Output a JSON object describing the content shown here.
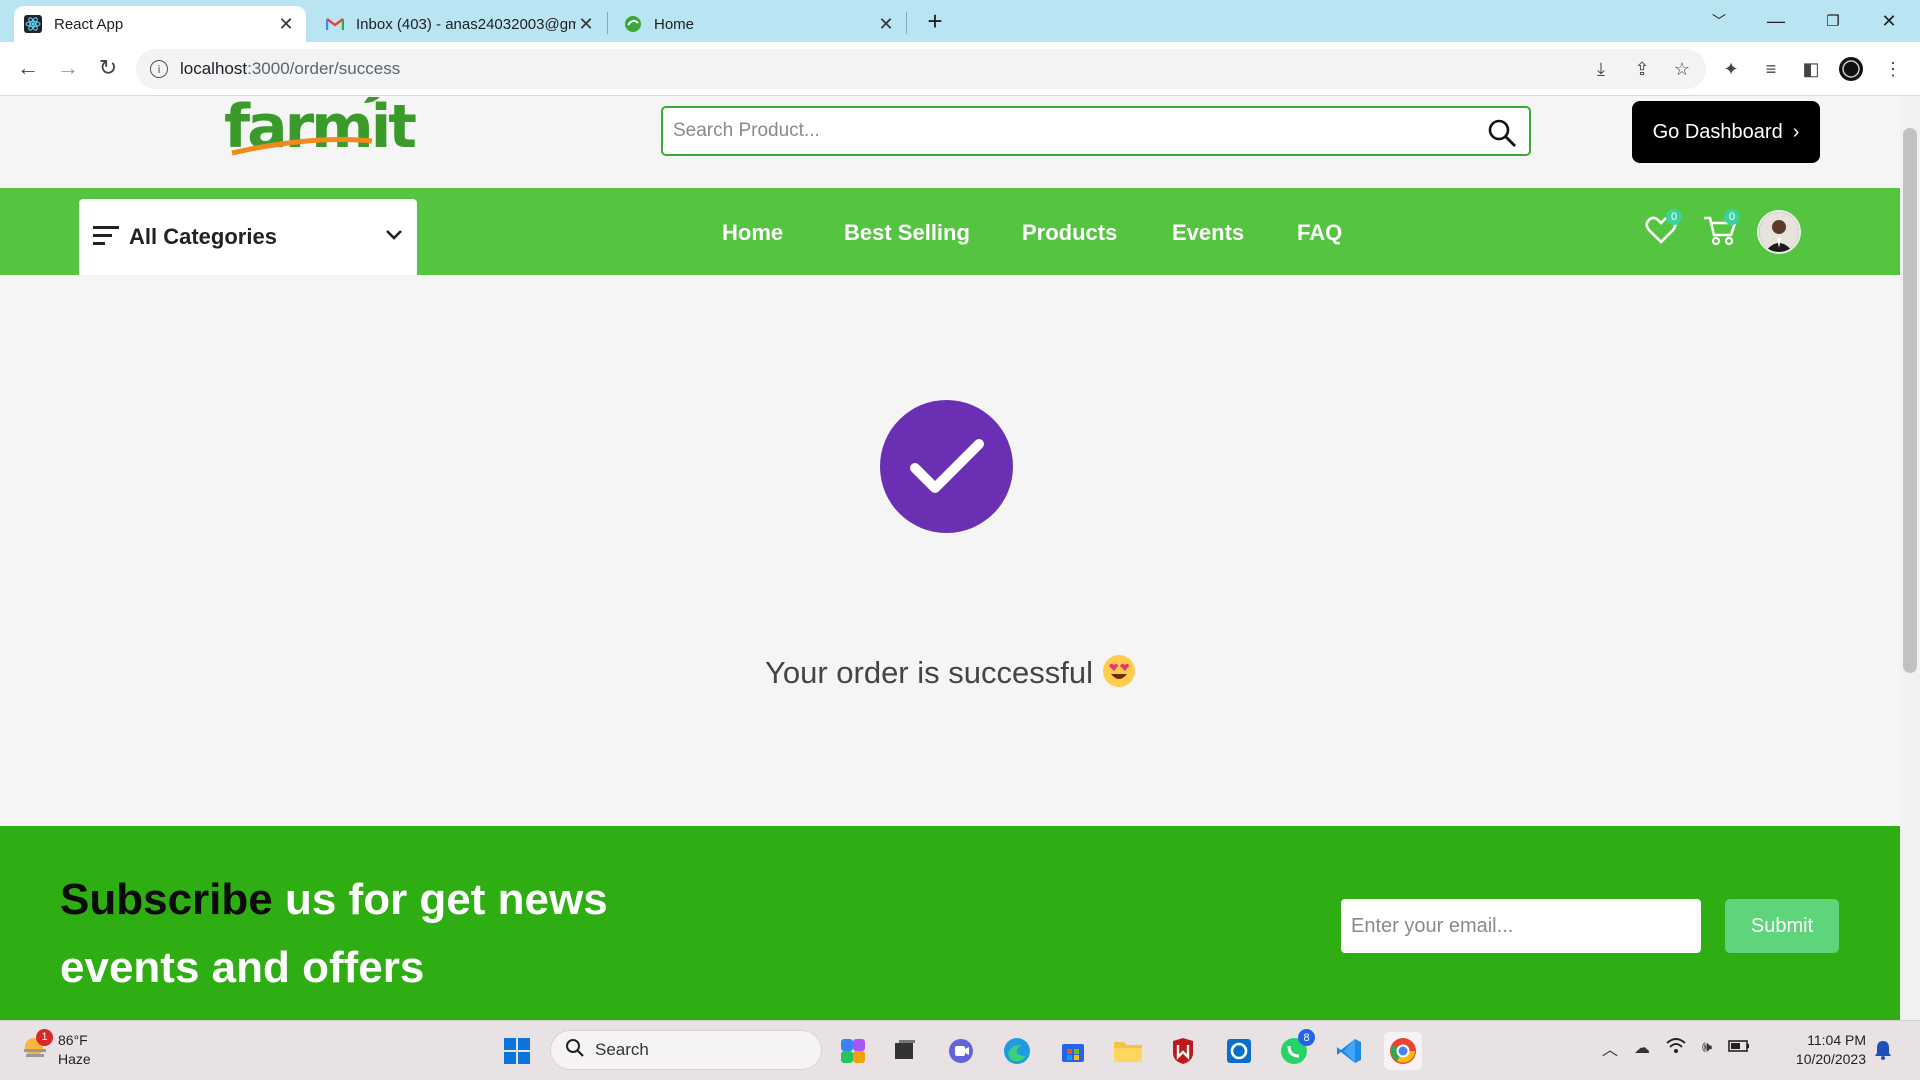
{
  "browser": {
    "tabs": [
      {
        "title": "React App",
        "active": true,
        "icon": "react-icon"
      },
      {
        "title": "Inbox (403) - anas24032003@gm",
        "active": false,
        "icon": "gmail-icon"
      },
      {
        "title": "Home",
        "active": false,
        "icon": "site-icon"
      }
    ],
    "url_host": "localhost",
    "url_path": ":3000/order/success"
  },
  "header": {
    "logo_text": "farmit",
    "search_placeholder": "Search Product...",
    "dashboard_label": "Go Dashboard"
  },
  "nav": {
    "categories_label": "All Categories",
    "links": [
      "Home",
      "Best Selling",
      "Products",
      "Events",
      "FAQ"
    ],
    "wishlist_count": "0",
    "cart_count": "0"
  },
  "content": {
    "message": "Your order is successful",
    "emoji_name": "heart-eyes-emoji"
  },
  "footer": {
    "subscribe_line1_dark": "Subscribe",
    "subscribe_line1_rest": " us for get news",
    "subscribe_line2": "events and offers",
    "email_placeholder": "Enter your email...",
    "submit_label": "Submit"
  },
  "taskbar": {
    "weather_temp": "86°F",
    "weather_desc": "Haze",
    "weather_alert": "1",
    "search_label": "Search",
    "whatsapp_badge": "8",
    "time": "11:04 PM",
    "date": "10/20/2023"
  },
  "colors": {
    "nav_green": "#55c441",
    "footer_green": "#2eae12",
    "check_purple": "#6b2fb3",
    "submit_green": "#5ed57a"
  }
}
